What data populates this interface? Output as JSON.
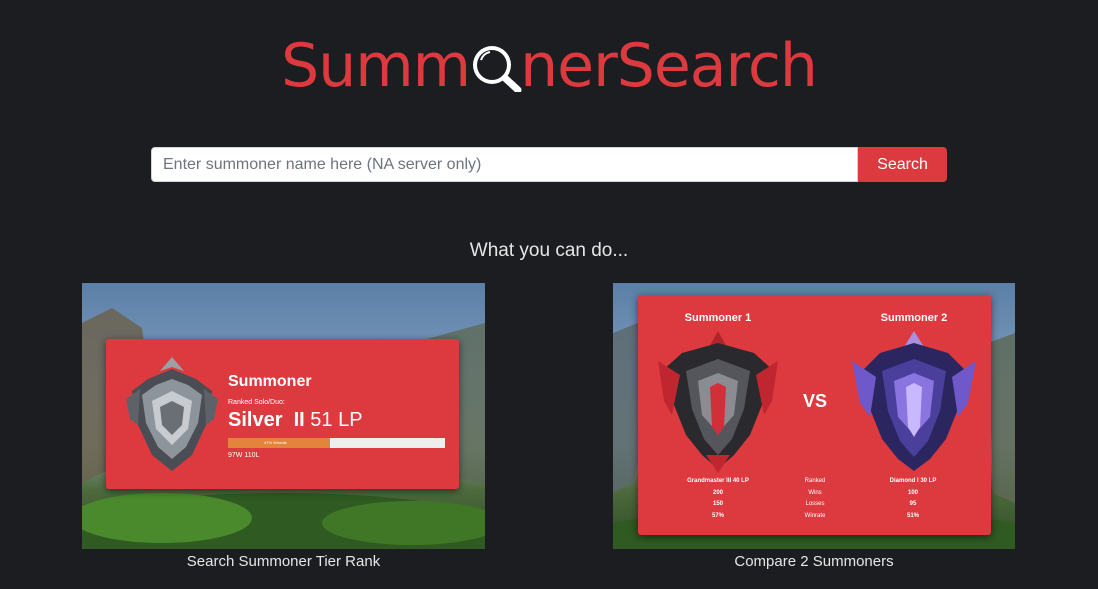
{
  "header": {
    "logo_text_before": "Summ",
    "logo_text_after": "nerSearch",
    "logo_color": "#dc3a3f",
    "logo_icon": "magnifier-icon"
  },
  "search": {
    "placeholder": "Enter summoner name here (NA server only)",
    "value": "",
    "button_label": "Search"
  },
  "section": {
    "title": "What you can do..."
  },
  "features": [
    {
      "caption": "Search Summoner Tier Rank",
      "preview": {
        "name": "Summoner",
        "queue": "Ranked Solo/Duo:",
        "tier": "Silver",
        "division": "II",
        "lp": "51 LP",
        "winrate_label": "47% Winrate",
        "winrate": 0.47,
        "record": "97W 110L",
        "emblem_icon": "silver-emblem-icon"
      }
    },
    {
      "caption": "Compare 2 Summoners",
      "preview": {
        "summoner1": "Summoner 1",
        "summoner2": "Summoner 2",
        "vs": "VS",
        "rank1": "Grandmaster III 40 LP",
        "rank_label": "Ranked",
        "rank2": "Diamond I 30 LP",
        "wins1": "200",
        "wins_label": "Wins",
        "wins2": "100",
        "losses1": "150",
        "losses_label": "Losses",
        "losses2": "95",
        "winrate1": "57%",
        "winrate_label": "Winrate",
        "winrate2": "51%",
        "emblem1_icon": "grandmaster-emblem-icon",
        "emblem2_icon": "diamond-emblem-icon"
      }
    }
  ],
  "colors": {
    "accent": "#dc3a3f",
    "background": "#1b1d21",
    "progress": "#e2853a"
  }
}
